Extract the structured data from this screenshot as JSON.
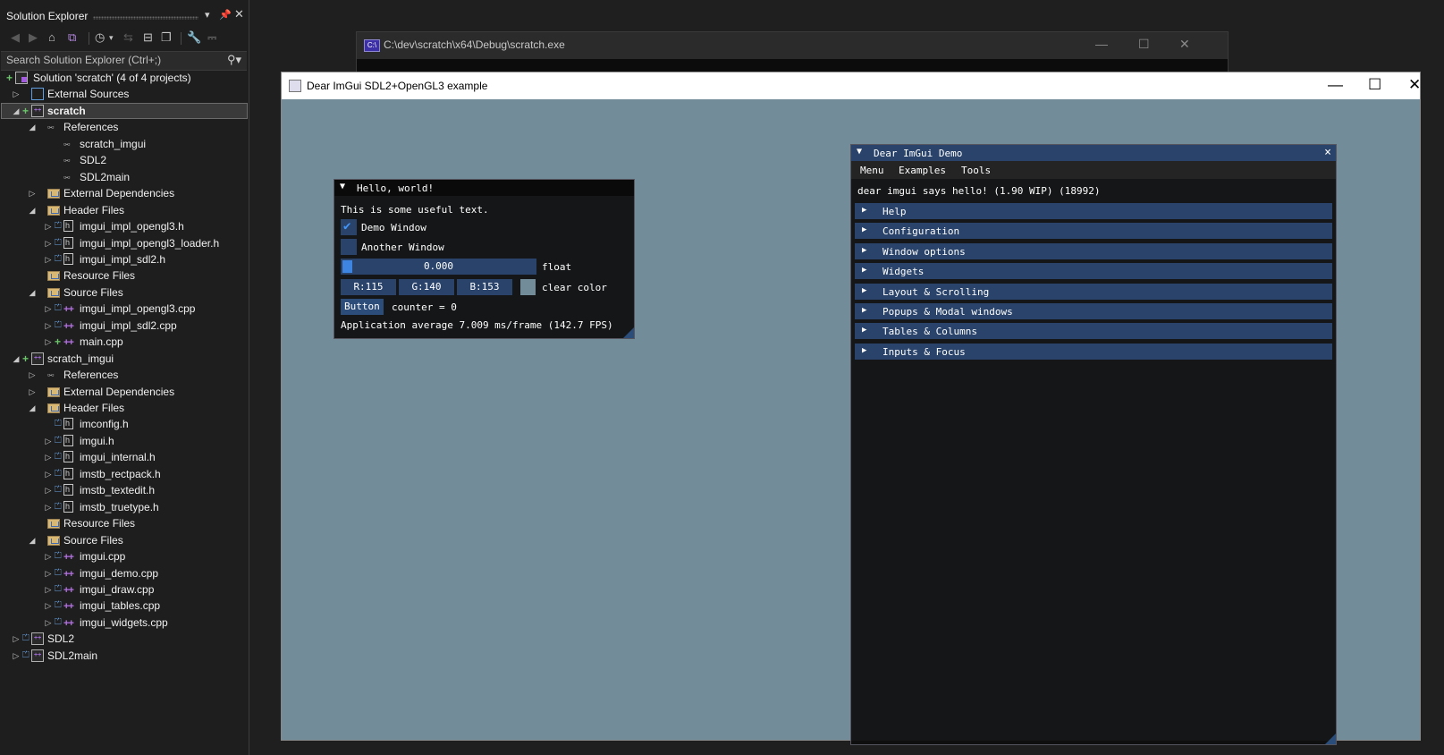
{
  "solution_explorer": {
    "title": "Solution Explorer",
    "search_placeholder": "Search Solution Explorer (Ctrl+;)",
    "toolbar_icons": [
      "back-icon",
      "forward-icon",
      "home-icon",
      "vs-switch-icon",
      "history-icon",
      "sync-icon",
      "collapse-all-icon",
      "show-all-files-icon",
      "properties-icon",
      "preview-icon"
    ],
    "tree": [
      {
        "label": "Solution 'scratch' (4 of 4 projects)",
        "depth": 0,
        "icon": "solution",
        "exp": "",
        "ind": "plus"
      },
      {
        "label": "External Sources",
        "depth": 1,
        "icon": "ext",
        "exp": "▷",
        "ind": ""
      },
      {
        "label": "scratch",
        "depth": 1,
        "icon": "proj",
        "exp": "◢",
        "ind": "plus",
        "selected": true,
        "bold": true
      },
      {
        "label": "References",
        "depth": 2,
        "icon": "ref",
        "exp": "◢",
        "ind": ""
      },
      {
        "label": "scratch_imgui",
        "depth": 3,
        "icon": "ref",
        "exp": "",
        "ind": ""
      },
      {
        "label": "SDL2",
        "depth": 3,
        "icon": "ref",
        "exp": "",
        "ind": ""
      },
      {
        "label": "SDL2main",
        "depth": 3,
        "icon": "ref",
        "exp": "",
        "ind": ""
      },
      {
        "label": "External Dependencies",
        "depth": 2,
        "icon": "folder",
        "exp": "▷",
        "ind": ""
      },
      {
        "label": "Header Files",
        "depth": 2,
        "icon": "folder",
        "exp": "◢",
        "ind": ""
      },
      {
        "label": "imgui_impl_opengl3.h",
        "depth": 3,
        "icon": "h",
        "exp": "▷",
        "ind": "lock"
      },
      {
        "label": "imgui_impl_opengl3_loader.h",
        "depth": 3,
        "icon": "h",
        "exp": "▷",
        "ind": "lock"
      },
      {
        "label": "imgui_impl_sdl2.h",
        "depth": 3,
        "icon": "h",
        "exp": "▷",
        "ind": "lock"
      },
      {
        "label": "Resource Files",
        "depth": 2,
        "icon": "folder",
        "exp": "",
        "ind": ""
      },
      {
        "label": "Source Files",
        "depth": 2,
        "icon": "folder",
        "exp": "◢",
        "ind": ""
      },
      {
        "label": "imgui_impl_opengl3.cpp",
        "depth": 3,
        "icon": "cpp",
        "exp": "▷",
        "ind": "lock"
      },
      {
        "label": "imgui_impl_sdl2.cpp",
        "depth": 3,
        "icon": "cpp",
        "exp": "▷",
        "ind": "lock"
      },
      {
        "label": "main.cpp",
        "depth": 3,
        "icon": "cpp",
        "exp": "▷",
        "ind": "plus"
      },
      {
        "label": "scratch_imgui",
        "depth": 1,
        "icon": "proj",
        "exp": "◢",
        "ind": "plus"
      },
      {
        "label": "References",
        "depth": 2,
        "icon": "ref",
        "exp": "▷",
        "ind": ""
      },
      {
        "label": "External Dependencies",
        "depth": 2,
        "icon": "folder",
        "exp": "▷",
        "ind": ""
      },
      {
        "label": "Header Files",
        "depth": 2,
        "icon": "folder",
        "exp": "◢",
        "ind": ""
      },
      {
        "label": "imconfig.h",
        "depth": 3,
        "icon": "h",
        "exp": "",
        "ind": "lock"
      },
      {
        "label": "imgui.h",
        "depth": 3,
        "icon": "h",
        "exp": "▷",
        "ind": "lock"
      },
      {
        "label": "imgui_internal.h",
        "depth": 3,
        "icon": "h",
        "exp": "▷",
        "ind": "lock"
      },
      {
        "label": "imstb_rectpack.h",
        "depth": 3,
        "icon": "h",
        "exp": "▷",
        "ind": "lock"
      },
      {
        "label": "imstb_textedit.h",
        "depth": 3,
        "icon": "h",
        "exp": "▷",
        "ind": "lock"
      },
      {
        "label": "imstb_truetype.h",
        "depth": 3,
        "icon": "h",
        "exp": "▷",
        "ind": "lock"
      },
      {
        "label": "Resource Files",
        "depth": 2,
        "icon": "folder",
        "exp": "",
        "ind": ""
      },
      {
        "label": "Source Files",
        "depth": 2,
        "icon": "folder",
        "exp": "◢",
        "ind": ""
      },
      {
        "label": "imgui.cpp",
        "depth": 3,
        "icon": "cpp",
        "exp": "▷",
        "ind": "lock"
      },
      {
        "label": "imgui_demo.cpp",
        "depth": 3,
        "icon": "cpp",
        "exp": "▷",
        "ind": "lock"
      },
      {
        "label": "imgui_draw.cpp",
        "depth": 3,
        "icon": "cpp",
        "exp": "▷",
        "ind": "lock"
      },
      {
        "label": "imgui_tables.cpp",
        "depth": 3,
        "icon": "cpp",
        "exp": "▷",
        "ind": "lock"
      },
      {
        "label": "imgui_widgets.cpp",
        "depth": 3,
        "icon": "cpp",
        "exp": "▷",
        "ind": "lock"
      },
      {
        "label": "SDL2",
        "depth": 1,
        "icon": "proj",
        "exp": "▷",
        "ind": "lock"
      },
      {
        "label": "SDL2main",
        "depth": 1,
        "icon": "proj",
        "exp": "▷",
        "ind": "lock"
      }
    ]
  },
  "console": {
    "title": "C:\\dev\\scratch\\x64\\Debug\\scratch.exe",
    "icon_text": "C:\\"
  },
  "sdl_window": {
    "title": "Dear ImGui SDL2+OpenGL3 example",
    "clear_color": "#738c99"
  },
  "hello_window": {
    "title": "Hello, world!",
    "text": "This is some useful text.",
    "demo_window": {
      "label": "Demo Window",
      "checked": true
    },
    "another_window": {
      "label": "Another Window",
      "checked": false
    },
    "slider": {
      "value": "0.000",
      "label": "float",
      "fraction": 0.0
    },
    "color": {
      "r": "R:115",
      "g": "G:140",
      "b": "B:153",
      "label": "clear color"
    },
    "button": {
      "label": "Button",
      "counter": "counter = 0"
    },
    "fps": "Application average 7.009 ms/frame (142.7 FPS)"
  },
  "demo_window": {
    "title": "Dear ImGui Demo",
    "close": "×",
    "menu": [
      "Menu",
      "Examples",
      "Tools"
    ],
    "says": "dear imgui says hello! (1.90 WIP) (18992)",
    "headers": [
      "Help",
      "Configuration",
      "Window options",
      "Widgets",
      "Layout & Scrolling",
      "Popups & Modal windows",
      "Tables & Columns",
      "Inputs & Focus"
    ]
  },
  "colors": {
    "imgui_frame": "#29436a",
    "imgui_accent": "#4296fa",
    "vs_background": "#1e1e1e"
  }
}
